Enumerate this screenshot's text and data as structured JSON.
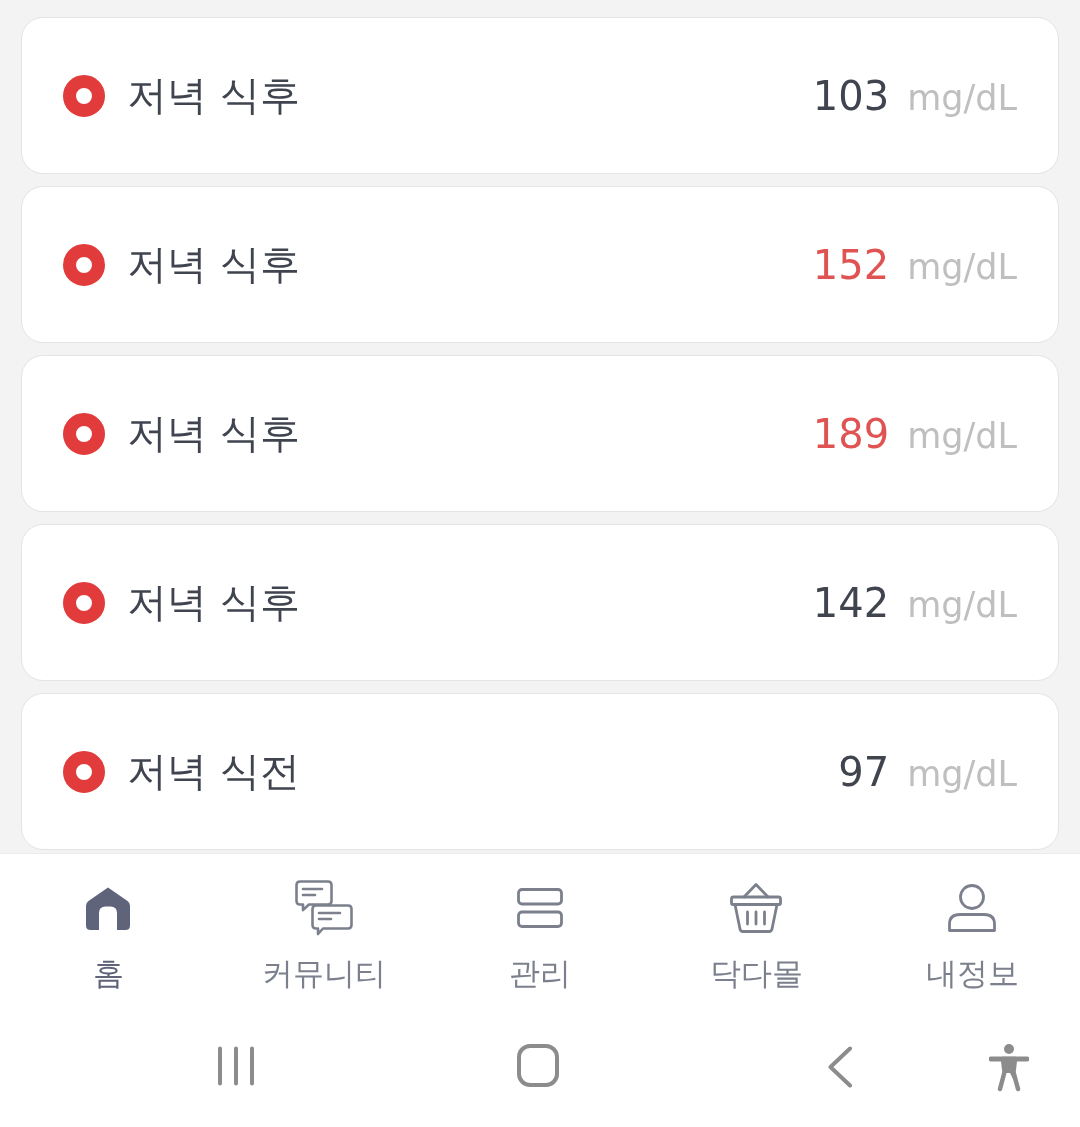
{
  "readings": [
    {
      "label": "저녁 식후",
      "value": "103",
      "unit": "mg/dL",
      "high": false
    },
    {
      "label": "저녁 식후",
      "value": "152",
      "unit": "mg/dL",
      "high": true
    },
    {
      "label": "저녁 식후",
      "value": "189",
      "unit": "mg/dL",
      "high": true
    },
    {
      "label": "저녁 식후",
      "value": "142",
      "unit": "mg/dL",
      "high": false
    },
    {
      "label": "저녁 식전",
      "value": "97",
      "unit": "mg/dL",
      "high": false
    }
  ],
  "bottom_nav": [
    {
      "kind": "home",
      "label": "홈",
      "selected": true
    },
    {
      "kind": "community",
      "label": "커뮤니티",
      "selected": false
    },
    {
      "kind": "manage",
      "label": "관리",
      "selected": false
    },
    {
      "kind": "mall",
      "label": "닥다몰",
      "selected": false
    },
    {
      "kind": "profile",
      "label": "내정보",
      "selected": false
    }
  ]
}
